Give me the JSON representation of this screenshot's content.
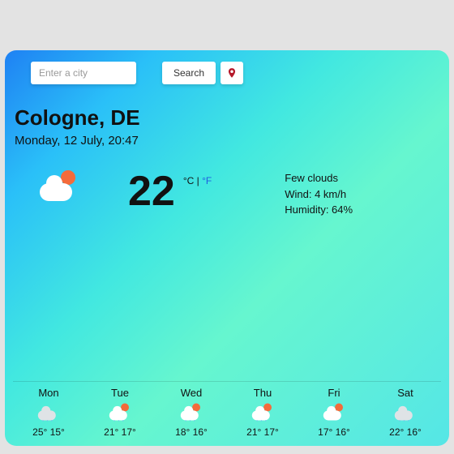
{
  "search": {
    "placeholder": "Enter a city",
    "button": "Search"
  },
  "location": "Cologne, DE",
  "datetime": "Monday, 12 July, 20:47",
  "current": {
    "temp": "22",
    "unit_c": "°C",
    "sep": " | ",
    "unit_f": "°F",
    "desc": "Few clouds",
    "wind": "Wind: 4 km/h",
    "humidity": "Humidity: 64%"
  },
  "forecast": [
    {
      "day": "Mon",
      "hi": "25°",
      "lo": "15°",
      "icon": "dark-rain"
    },
    {
      "day": "Tue",
      "hi": "21°",
      "lo": "17°",
      "icon": "sun-rain"
    },
    {
      "day": "Wed",
      "hi": "18°",
      "lo": "16°",
      "icon": "sun-rain"
    },
    {
      "day": "Thu",
      "hi": "21°",
      "lo": "17°",
      "icon": "sun-rain"
    },
    {
      "day": "Fri",
      "hi": "17°",
      "lo": "16°",
      "icon": "sun-cloud"
    },
    {
      "day": "Sat",
      "hi": "22°",
      "lo": "16°",
      "icon": "dark-rain"
    }
  ]
}
